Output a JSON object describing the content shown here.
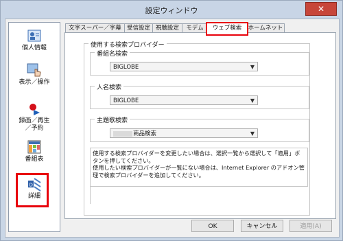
{
  "window": {
    "title": "設定ウィンドウ",
    "close_glyph": "✕"
  },
  "sidebar": {
    "items": [
      {
        "label": "個人情報",
        "icon": "person-card-icon"
      },
      {
        "label": "表示／操作",
        "icon": "hand-cursor-icon"
      },
      {
        "label": "録画／再生\n／予約",
        "icon": "record-play-icon"
      },
      {
        "label": "番組表",
        "icon": "program-grid-icon"
      },
      {
        "label": "詳細",
        "icon": "network-detail-icon"
      }
    ]
  },
  "tabs": [
    {
      "label": "文字スーパー／字幕"
    },
    {
      "label": "受信設定"
    },
    {
      "label": "視聴設定"
    },
    {
      "label": "モデム"
    },
    {
      "label": "ウェブ検索",
      "active": true
    },
    {
      "label": "ホームネット"
    }
  ],
  "search": {
    "group_title": "使用する検索プロバイダー",
    "program": {
      "label": "番組名検索",
      "value": "BIGLOBE"
    },
    "person": {
      "label": "人名検索",
      "value": "BIGLOBE"
    },
    "song": {
      "label": "主題歌検索",
      "value": "商品検索"
    },
    "info_text": "使用する検索プロバイダーを変更したい場合は、選択一覧から選択して「適用」ボタンを押してください。\n使用したい検索プロバイダーが一覧にない場合は、Internet Explorer のアドオン管理で検索プロバイダーを追加してください。"
  },
  "buttons": {
    "ok": "OK",
    "cancel": "キャンセル",
    "apply": "適用(A)"
  },
  "colors": {
    "highlight": "#e8000b",
    "close": "#c7463a"
  }
}
